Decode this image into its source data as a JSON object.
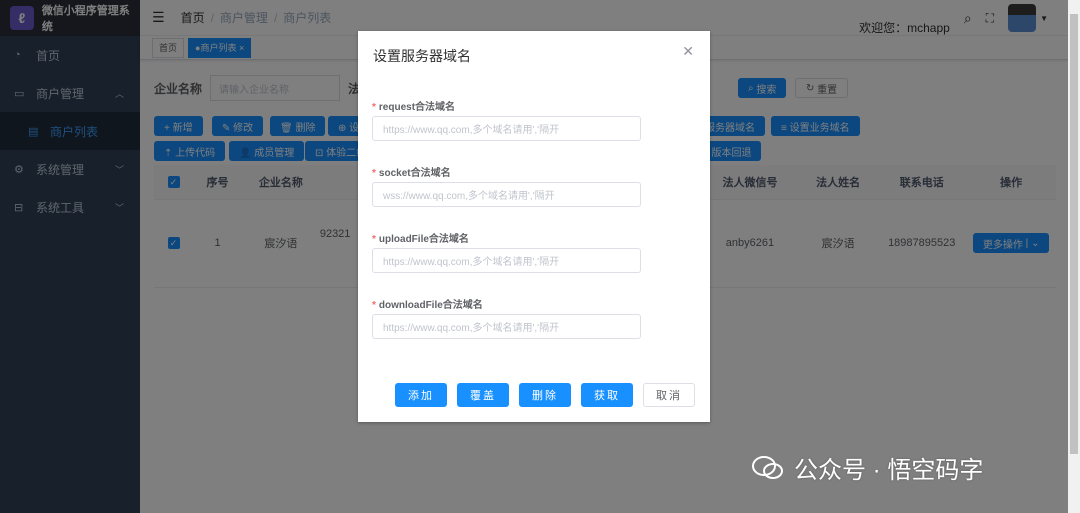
{
  "app": {
    "title": "微信小程序管理系统"
  },
  "sidebar": {
    "items": [
      {
        "label": "首页"
      },
      {
        "label": "商户管理"
      },
      {
        "label": "商户列表"
      },
      {
        "label": "系统管理"
      },
      {
        "label": "系统工具"
      }
    ]
  },
  "navbar": {
    "breadcrumb": [
      "首页",
      "商户管理",
      "商户列表"
    ],
    "welcome": "欢迎您：mchapp"
  },
  "tags": [
    {
      "label": "首页"
    },
    {
      "label": "商户列表"
    }
  ],
  "search": {
    "label": "企业名称",
    "placeholder": "请输入企业名称",
    "label2": "法",
    "search": "搜索",
    "reset": "重置"
  },
  "toolbar": {
    "row1": [
      "+ 新增",
      "✎ 修改",
      "🗑 删除",
      "⊕ 设",
      "服务器域名",
      "≡ 设置业务域名"
    ],
    "row2": [
      "⇡ 上传代码",
      "👤 成员管理",
      "⊡ 体验二维",
      "⤺ 版本回退"
    ]
  },
  "table": {
    "headers": [
      "序号",
      "企业名称",
      "法人微信号",
      "法人姓名",
      "联系电话",
      "操作"
    ],
    "rows": [
      {
        "index": "1",
        "company": "宸汐语",
        "partial": "92321",
        "wechat": "anby6261",
        "name": "宸汐语",
        "phone": "18987895523",
        "action": "更多操作"
      }
    ]
  },
  "modal": {
    "title": "设置服务器域名",
    "fields": [
      {
        "label": "request合法域名",
        "placeholder": "https://www.qq.com,多个域名请用','隔开"
      },
      {
        "label": "socket合法域名",
        "placeholder": "wss://www.qq.com,多个域名请用','隔开"
      },
      {
        "label": "uploadFile合法域名",
        "placeholder": "https://www.qq.com,多个域名请用','隔开"
      },
      {
        "label": "downloadFile合法域名",
        "placeholder": "https://www.qq.com,多个域名请用','隔开"
      }
    ],
    "buttons": {
      "add": "添加",
      "cover": "覆盖",
      "delete": "删除",
      "fetch": "获取",
      "cancel": "取消"
    }
  },
  "watermark": {
    "text": "公众号 · 悟空码字"
  },
  "colors": {
    "primary": "#1890ff",
    "sidebar": "#304156"
  }
}
